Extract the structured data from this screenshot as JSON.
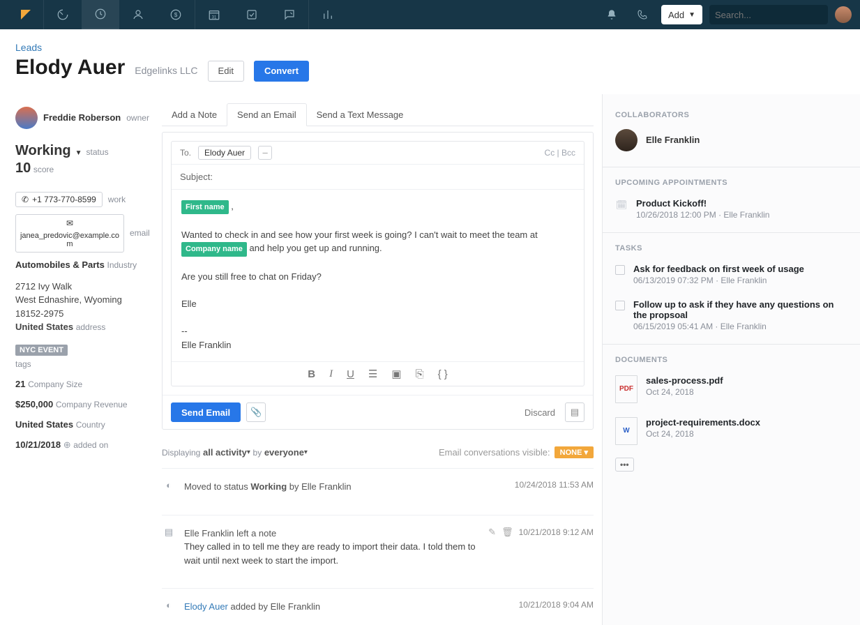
{
  "topnav": {
    "add_label": "Add",
    "search_placeholder": "Search..."
  },
  "header": {
    "breadcrumb": "Leads",
    "lead_name": "Elody Auer",
    "company": "Edgelinks LLC",
    "edit_label": "Edit",
    "convert_label": "Convert"
  },
  "owner": {
    "name": "Freddie Roberson",
    "role": "owner"
  },
  "status": {
    "label": "status",
    "value": "Working",
    "score_value": "10",
    "score_label": "score"
  },
  "contact": {
    "phone": "+1 773-770-8599",
    "phone_type": "work",
    "email": "janea_predovic@example.com",
    "email_type": "email",
    "industry_value": "Automobiles & Parts",
    "industry_label": "Industry",
    "address_line1": "2712 Ivy Walk",
    "address_line2": "West Ednashire, Wyoming 18152-2975",
    "address_country": "United States",
    "address_label": "address",
    "tag": "NYC EVENT",
    "tags_label": "tags",
    "size_value": "21",
    "size_label": "Company Size",
    "revenue_value": "$250,000",
    "revenue_label": "Company Revenue",
    "country_value": "United States",
    "country_label": "Country",
    "added_value": "10/21/2018",
    "added_label": "added on"
  },
  "tabs": {
    "note": "Add a Note",
    "email": "Send an Email",
    "text": "Send a Text Message"
  },
  "composer": {
    "to_label": "To.",
    "to_name": "Elody Auer",
    "ccbcc": "Cc | Bcc",
    "subject_label": "Subject:",
    "merge_first_name": "First name",
    "merge_company": "Company name",
    "body_line1": "Wanted to check in and see how your first week is going? I can't wait to meet the team at",
    "body_line1b": "and help you get up and running.",
    "body_line2": "Are you still free to chat on Friday?",
    "body_sign1": "Elle",
    "body_sign2": "--",
    "body_sign3": "Elle Franklin",
    "send_label": "Send Email",
    "discard_label": "Discard"
  },
  "activity_filter": {
    "displaying": "Displaying",
    "all_activity": "all activity",
    "by": "by",
    "everyone": "everyone",
    "vis_label": "Email conversations visible:",
    "none": "NONE"
  },
  "feed": [
    {
      "icon": "status",
      "text_prefix": "Moved to status ",
      "text_bold": "Working",
      "text_suffix": " by Elle Franklin",
      "time": "10/24/2018 11:53 AM"
    },
    {
      "icon": "note",
      "text_prefix": "Elle Franklin left a note",
      "body": "They called in to tell me they are ready to import their data. I told them to wait until next week to start the import.",
      "time": "10/21/2018 9:12 AM",
      "editable": true
    },
    {
      "icon": "status",
      "link_text": "Elody Auer",
      "text_suffix": " added by Elle Franklin",
      "time": "10/21/2018 9:04 AM"
    }
  ],
  "sidebar": {
    "collaborators_label": "COLLABORATORS",
    "collaborator_name": "Elle Franklin",
    "appointments_label": "UPCOMING APPOINTMENTS",
    "appointment_title": "Product Kickoff!",
    "appointment_meta": "10/26/2018 12:00 PM · Elle Franklin",
    "tasks_label": "TASKS",
    "tasks": [
      {
        "title": "Ask for feedback on first week of usage",
        "meta": "06/13/2019 07:32 PM · Elle Franklin"
      },
      {
        "title": "Follow up to ask if they have any questions on the propsoal",
        "meta": "06/15/2019 05:41 AM · Elle Franklin"
      }
    ],
    "documents_label": "DOCUMENTS",
    "documents": [
      {
        "name": "sales-process.pdf",
        "date": "Oct 24, 2018",
        "type": "pdf"
      },
      {
        "name": "project-requirements.docx",
        "date": "Oct 24, 2018",
        "type": "doc"
      }
    ],
    "more": "•••"
  }
}
